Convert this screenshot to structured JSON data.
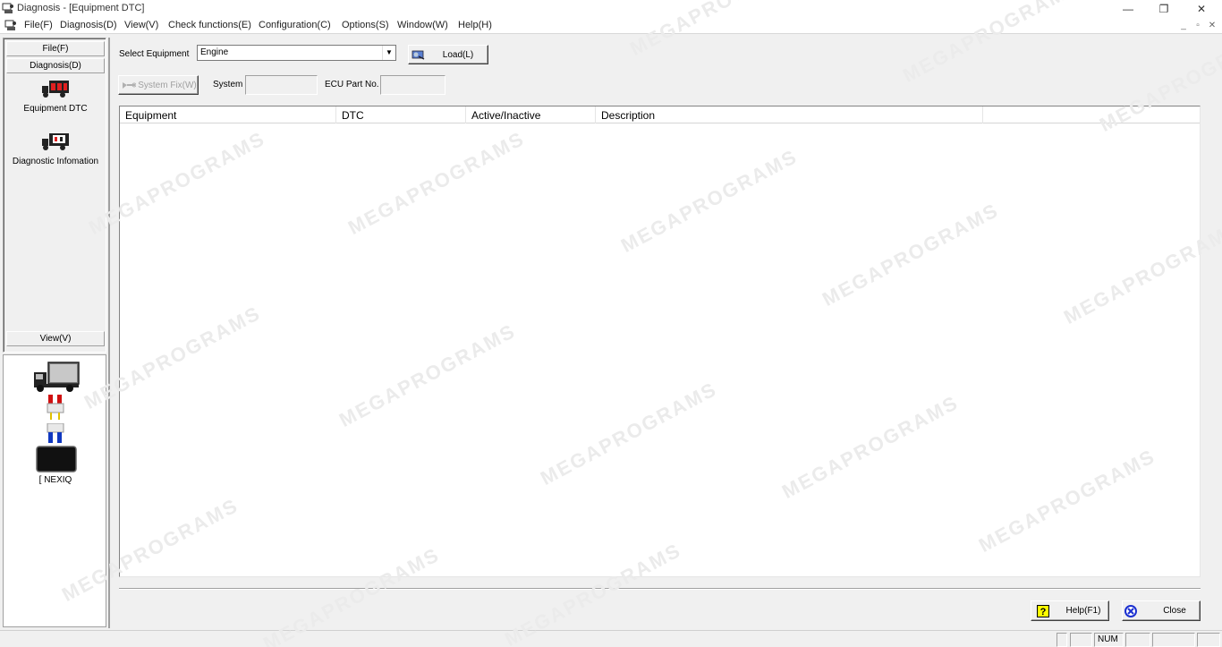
{
  "window": {
    "title": "Diagnosis - [Equipment DTC]",
    "controls": [
      "—",
      "❐",
      "✕"
    ]
  },
  "menu": {
    "items": [
      "File(F)",
      "Diagnosis(D)",
      "View(V)",
      "Check functions(E)",
      "Configuration(C)",
      "Options(S)",
      "Window(W)",
      "Help(H)"
    ],
    "mdi_controls": [
      "_",
      "▫",
      "✕"
    ]
  },
  "sidebar": {
    "file_header": "File(F)",
    "diagnosis_header": "Diagnosis(D)",
    "view_header": "View(V)",
    "items": [
      {
        "label": "Equipment DTC",
        "icon": "truck-dtc-icon"
      },
      {
        "label": "Diagnostic Infomation",
        "icon": "truck-info-icon"
      }
    ],
    "device_label": "[ NEXIQ"
  },
  "toolbar": {
    "select_equipment_label": "Select Equipment",
    "select_equipment_value": "Engine",
    "load_label": "Load(L)",
    "system_fix_label": "System Fix(W)",
    "system_label": "System",
    "system_value": "",
    "ecu_label": "ECU Part No.",
    "ecu_value": ""
  },
  "table": {
    "columns": [
      "Equipment",
      "DTC",
      "Active/Inactive",
      "Description"
    ],
    "rows": []
  },
  "buttons": {
    "help_label": "Help(F1)",
    "close_label": "Close"
  },
  "statusbar": {
    "num": "NUM"
  },
  "watermark": "MEGAPROGRAMS",
  "colors": {
    "help_icon_bg": "#ffff00",
    "close_icon": "#1a2fd0",
    "window_bg": "#f0f0f0"
  }
}
